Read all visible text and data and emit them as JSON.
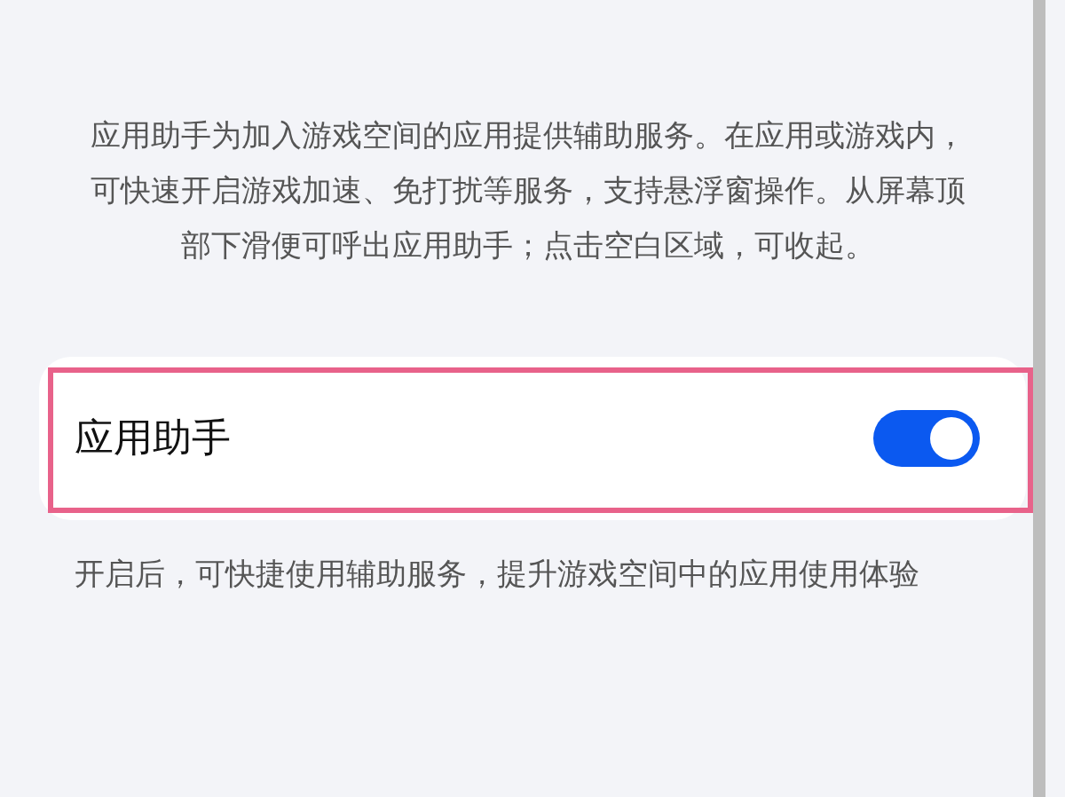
{
  "description": "应用助手为加入游戏空间的应用提供辅助服务。在应用或游戏内，可快速开启游戏加速、免打扰等服务，支持悬浮窗操作。从屏幕顶部下滑便可呼出应用助手；点击空白区域，可收起。",
  "setting": {
    "label": "应用助手",
    "on": true,
    "highlighted": true
  },
  "footnote": "开启后，可快捷使用辅助服务，提升游戏空间中的应用使用体验"
}
